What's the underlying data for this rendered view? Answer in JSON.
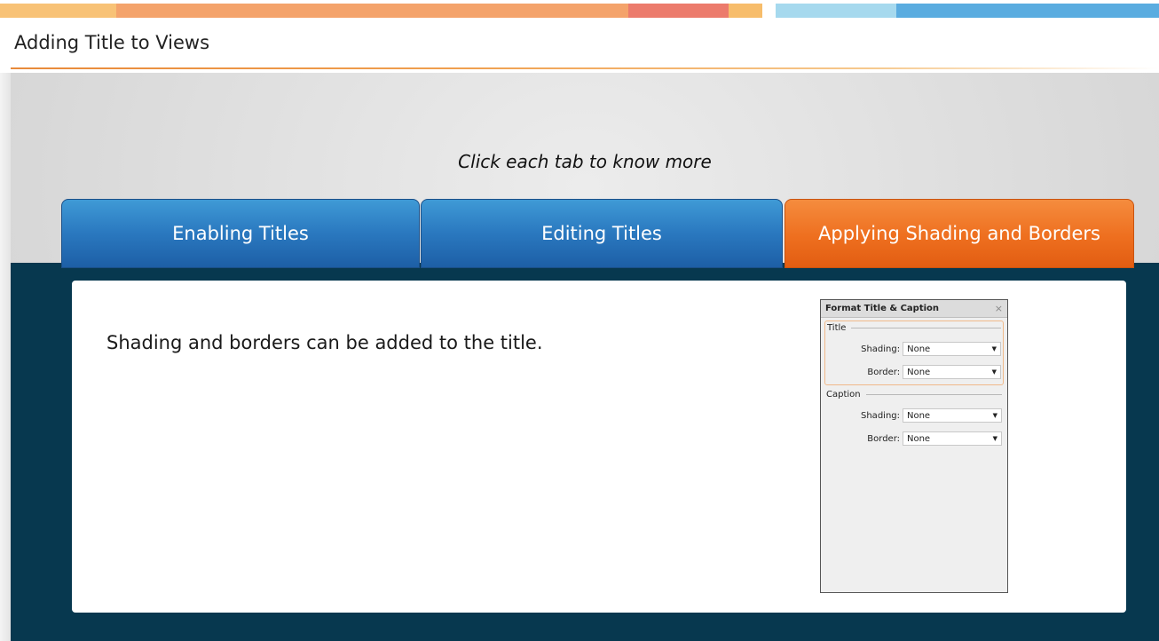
{
  "header": {
    "title": "Adding Title to Views"
  },
  "colors": {
    "strip": [
      "#f8c276",
      "#f4a36b",
      "#ec7b6c",
      "#f7bd6b",
      "#a6d9ee",
      "#5aace0"
    ],
    "tab_active": "#ee6f1f",
    "tab_inactive": "#2a78bf",
    "band": "#07384f"
  },
  "slide": {
    "instruction": "Click each tab to know more",
    "tabs": [
      {
        "label": "Enabling Titles",
        "active": false
      },
      {
        "label": "Editing Titles",
        "active": false
      },
      {
        "label": "Applying Shading and Borders",
        "active": true
      }
    ],
    "content_text": "Shading and borders can be added to the title."
  },
  "dialog": {
    "title": "Format Title & Caption",
    "close_icon": "×",
    "dropdown_icon": "▼",
    "groups": [
      {
        "label": "Title",
        "rows": [
          {
            "label": "Shading:",
            "value": "None"
          },
          {
            "label": "Border:",
            "value": "None"
          }
        ]
      },
      {
        "label": "Caption",
        "rows": [
          {
            "label": "Shading:",
            "value": "None"
          },
          {
            "label": "Border:",
            "value": "None"
          }
        ]
      }
    ]
  }
}
